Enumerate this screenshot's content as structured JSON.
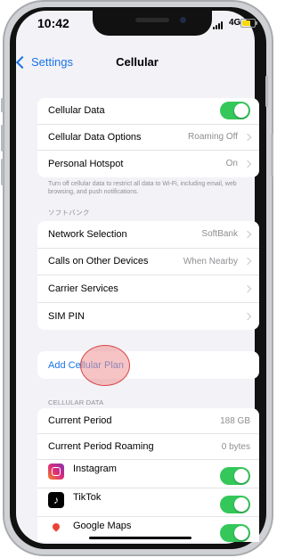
{
  "status_bar": {
    "time": "10:42",
    "network": "4G"
  },
  "nav": {
    "back_label": "Settings",
    "title": "Cellular"
  },
  "group1": [
    {
      "label": "Cellular Data",
      "value": "",
      "toggle": true
    },
    {
      "label": "Cellular Data Options",
      "value": "Roaming Off",
      "chevron": true
    },
    {
      "label": "Personal Hotspot",
      "value": "On",
      "chevron": true
    }
  ],
  "footnote": "Turn off cellular data to restrict all data to Wi-Fi, including email, web browsing, and push notifications.",
  "carrier_header": "ソフトバンク",
  "group2": [
    {
      "label": "Network Selection",
      "value": "SoftBank"
    },
    {
      "label": "Calls on Other Devices",
      "value": "When Nearby"
    },
    {
      "label": "Carrier Services",
      "value": ""
    },
    {
      "label": "SIM PIN",
      "value": ""
    }
  ],
  "add_plan_label": "Add Cellular Plan",
  "cellular_data_header": "CELLULAR DATA",
  "usage": [
    {
      "label": "Current Period",
      "value": "188 GB"
    },
    {
      "label": "Current Period Roaming",
      "value": "0 bytes"
    }
  ],
  "apps": [
    {
      "name": "Instagram",
      "icon": "instagram-icon",
      "enabled": true
    },
    {
      "name": "TikTok",
      "icon": "tiktok-icon",
      "enabled": true
    },
    {
      "name": "Google Maps",
      "icon": "google-maps-icon",
      "enabled": true
    }
  ],
  "colors": {
    "accent": "#1a73e8",
    "toggle_on": "#34c759",
    "background": "#f2f2f7"
  }
}
